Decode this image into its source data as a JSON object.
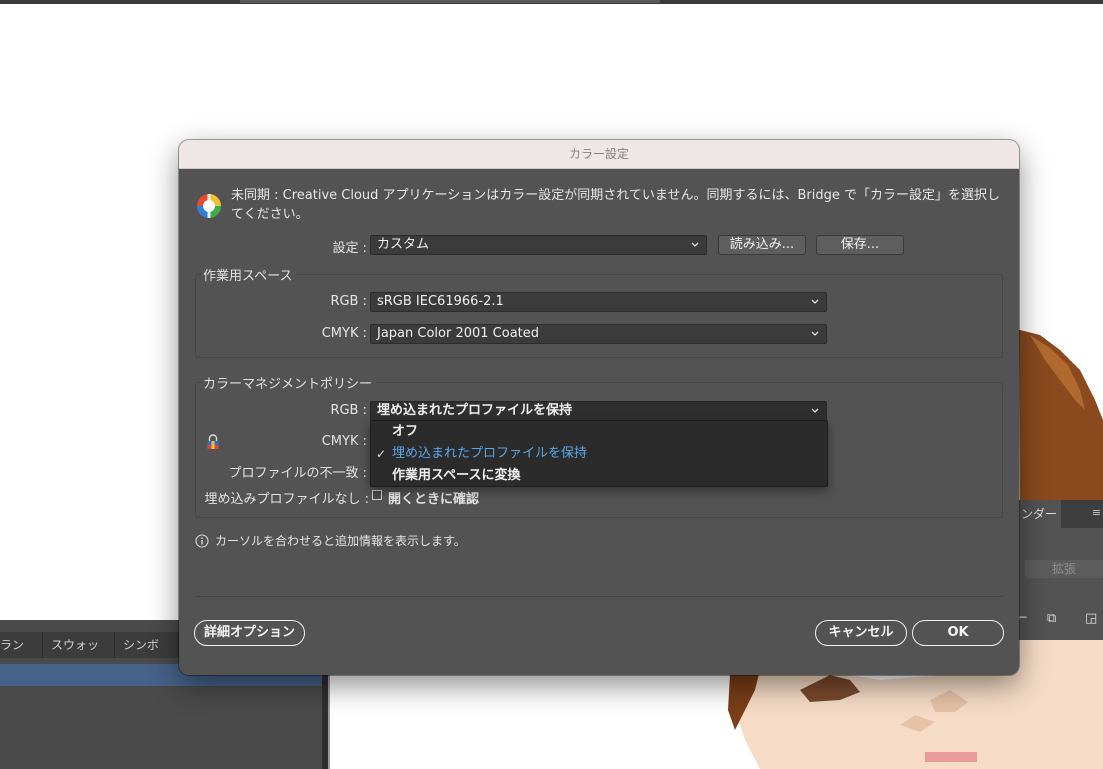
{
  "dialog": {
    "title": "カラー設定",
    "sync_message": "未同期 : Creative Cloud アプリケーションはカラー設定が同期されていません。同期するには、Bridge で「カラー設定」を選択してください。",
    "settings": {
      "label": "設定 :",
      "value": "カスタム",
      "load_button": "読み込み...",
      "save_button": "保存..."
    },
    "working_spaces": {
      "title": "作業用スペース",
      "rgb_label": "RGB :",
      "rgb_value": "sRGB IEC61966-2.1",
      "cmyk_label": "CMYK :",
      "cmyk_value": "Japan Color 2001 Coated"
    },
    "policies": {
      "title": "カラーマネジメントポリシー",
      "rgb_label": "RGB :",
      "rgb_value": "埋め込まれたプロファイルを保持",
      "cmyk_label": "CMYK :",
      "mismatch_label": "プロファイルの不一致 :",
      "missing_label": "埋め込みプロファイルなし :",
      "missing_checkbox_label": "開くときに確認",
      "missing_checked": false
    },
    "dropdown_options": [
      {
        "label": "オフ",
        "selected": false
      },
      {
        "label": "埋め込まれたプロファイルを保持",
        "selected": true
      },
      {
        "label": "作業用スペースに変換",
        "selected": false
      }
    ],
    "info_text": "カーソルを合わせると追加情報を表示します。",
    "advanced_button": "詳細オプション",
    "cancel_button": "キャンセル",
    "ok_button": "OK"
  },
  "left_panel": {
    "tabs": [
      "ランス",
      "スウォッチ",
      "シンボル"
    ]
  },
  "right_panel": {
    "tab": "ンダー",
    "menu_icon": "≡",
    "expand_label": "拡張"
  },
  "colors": {
    "dialog_bg": "#535353",
    "title_bg": "#efe6e6",
    "selection_blue": "#5aa7e8",
    "panel_selection": "#466289"
  }
}
